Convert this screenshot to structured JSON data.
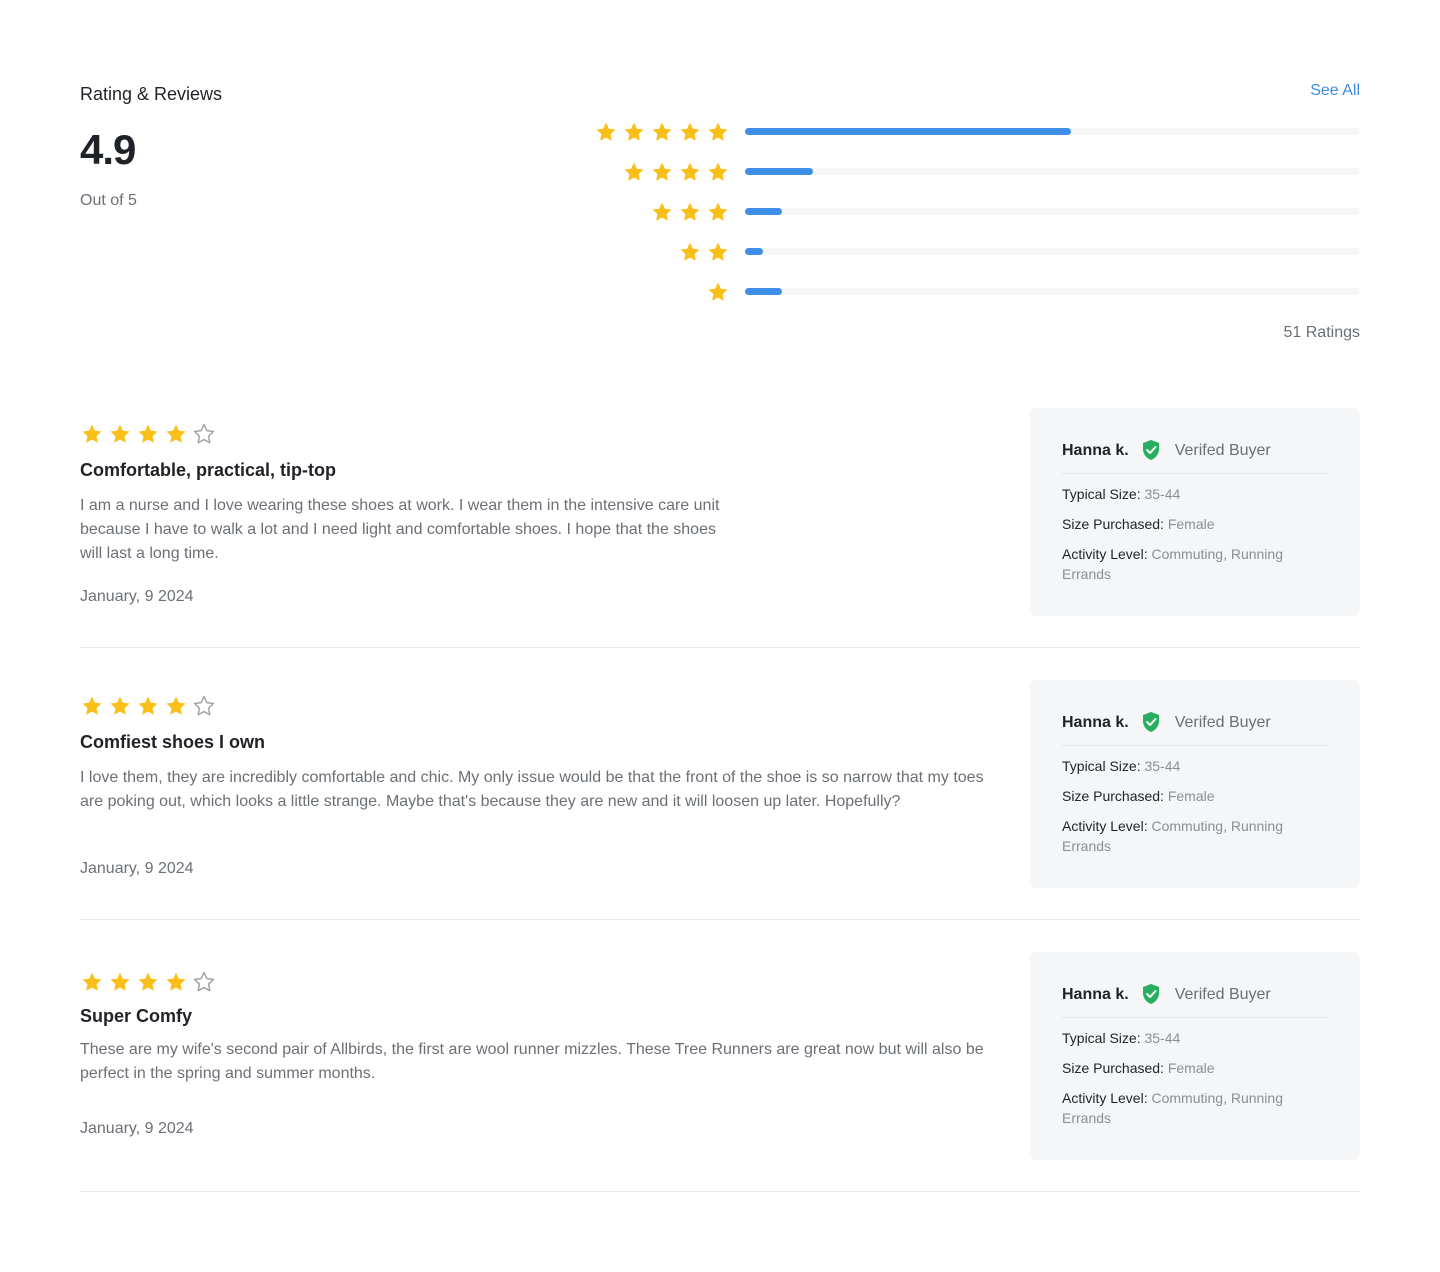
{
  "summary": {
    "title": "Rating & Reviews",
    "see_all": "See All",
    "average": "4.9",
    "out_of": "Out of 5",
    "total": "51 Ratings",
    "distribution": [
      {
        "stars": 5,
        "fraction": 0.53
      },
      {
        "stars": 4,
        "fraction": 0.11
      },
      {
        "stars": 3,
        "fraction": 0.06
      },
      {
        "stars": 2,
        "fraction": 0.03
      },
      {
        "stars": 1,
        "fraction": 0.06
      }
    ]
  },
  "colors": {
    "star": "#fbbf1a",
    "star_empty": "#9aa0a6",
    "bar": "#3f8fe8",
    "bar_track": "#f5f6f7",
    "verified": "#27ae60",
    "link": "#3d8ce6"
  },
  "icons": {
    "star": "star-icon",
    "verified": "shield-check-icon"
  },
  "reviews": [
    {
      "rating": 4,
      "title": "Comfortable, practical, tip-top",
      "body": "I am a nurse and I love wearing these shoes at work. I wear them in the intensive care unit because I have to walk a lot and I need light and comfortable shoes. I hope that the shoes will last a long time.",
      "date": "January, 9 2024",
      "buyer": {
        "name": "Hanna k.",
        "badge": "Verifed Buyer",
        "typical_size_label": "Typical Size:",
        "typical_size": "35-44",
        "size_purchased_label": "Size Purchased:",
        "size_purchased": "Female",
        "activity_label": "Activity Level:",
        "activity": "Commuting, Running Errands"
      }
    },
    {
      "rating": 4,
      "title": "Comfiest shoes I own",
      "body": "I love them, they are incredibly comfortable and chic. My only issue would be that the front of the shoe is so narrow that my toes are poking out, which looks a little strange. Maybe that's because they are new and it will loosen up later. Hopefully?",
      "date": "January, 9 2024",
      "buyer": {
        "name": "Hanna k.",
        "badge": "Verifed Buyer",
        "typical_size_label": "Typical Size:",
        "typical_size": "35-44",
        "size_purchased_label": "Size Purchased:",
        "size_purchased": "Female",
        "activity_label": "Activity Level:",
        "activity": "Commuting, Running Errands"
      }
    },
    {
      "rating": 4,
      "title": "Super Comfy",
      "body": "These are my wife's second pair of Allbirds, the first are wool runner mizzles. These Tree Runners are great now but will also be perfect in the spring and summer months.",
      "date": "January, 9 2024",
      "buyer": {
        "name": "Hanna k.",
        "badge": "Verifed Buyer",
        "typical_size_label": "Typical Size:",
        "typical_size": "35-44",
        "size_purchased_label": "Size Purchased:",
        "size_purchased": "Female",
        "activity_label": "Activity Level:",
        "activity": "Commuting, Running Errands"
      }
    }
  ]
}
